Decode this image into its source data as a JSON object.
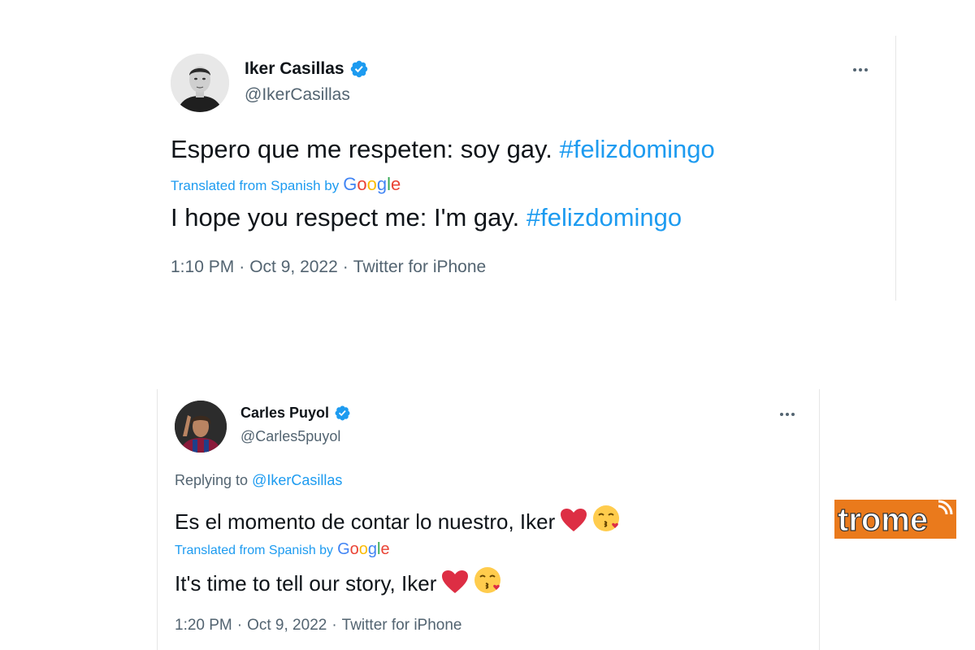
{
  "tweets": [
    {
      "display_name": "Iker Casillas",
      "handle": "@IkerCasillas",
      "original_text": "Espero que me respeten: soy gay.",
      "original_hashtag": "#felizdomingo",
      "translated_from": "Translated from Spanish by",
      "translated_text": "I hope you respect me: I'm gay.",
      "translated_hashtag": "#felizdomingo",
      "time": "1:10 PM",
      "date": "Oct 9, 2022",
      "source": "Twitter for iPhone"
    },
    {
      "display_name": "Carles Puyol",
      "handle": "@Carles5puyol",
      "replying_label": "Replying to",
      "replying_to": "@IkerCasillas",
      "original_text": "Es el momento de contar lo nuestro, Iker",
      "translated_from": "Translated from Spanish by",
      "translated_text": "It's time to tell our story, Iker",
      "time": "1:20 PM",
      "date": "Oct 9, 2022",
      "source": "Twitter for iPhone"
    }
  ],
  "separator": "·",
  "google": {
    "letters": [
      "G",
      "o",
      "o",
      "g",
      "l",
      "e"
    ]
  },
  "icons": {
    "verified": "verified-badge-icon",
    "more": "more-options-icon",
    "heart_emoji": "red-heart-emoji",
    "kiss_emoji": "face-blowing-kiss-emoji"
  },
  "watermark": {
    "text": "trome"
  },
  "colors": {
    "link_blue": "#1d9bf0",
    "secondary_text": "#536471",
    "primary_text": "#0f1419",
    "trome_orange": "#ea7a1c"
  }
}
